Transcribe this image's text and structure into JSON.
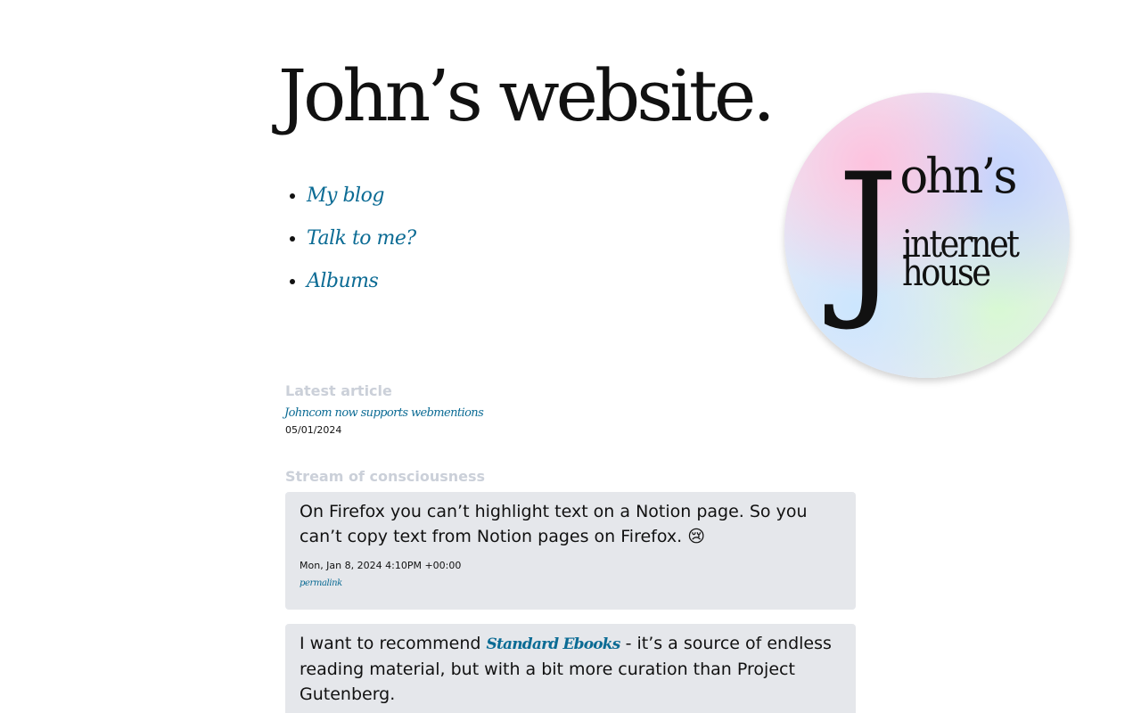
{
  "header": {
    "site_title": "John’s website."
  },
  "nav": {
    "items": [
      {
        "label": "My blog"
      },
      {
        "label": "Talk to me?"
      },
      {
        "label": "Albums"
      }
    ]
  },
  "logo": {
    "line_big_letter": "J",
    "line_1": "ohn’s",
    "line_2": "internet",
    "line_3": "house"
  },
  "latest": {
    "heading": "Latest article",
    "title": "Johncom now supports webmentions",
    "date": "05/01/2024"
  },
  "stream": {
    "heading": "Stream of consciousness",
    "notes": [
      {
        "text": "On Firefox you can’t highlight text on a Notion page. So you can’t copy text from Notion pages on Firefox. 😢",
        "timestamp": "Mon, Jan 8, 2024 4:10PM +00:00",
        "permalink_label": "permalink"
      },
      {
        "text_before": "I want to recommend ",
        "link_label": "Standard Ebooks",
        "text_after": " - it’s a source of endless reading material, but with a bit more curation than Project Gutenberg."
      }
    ]
  },
  "colors": {
    "link": "#0b6b94",
    "heading_muted": "#cbd0d9",
    "card_background": "#e5e7eb",
    "text": "#111111"
  }
}
